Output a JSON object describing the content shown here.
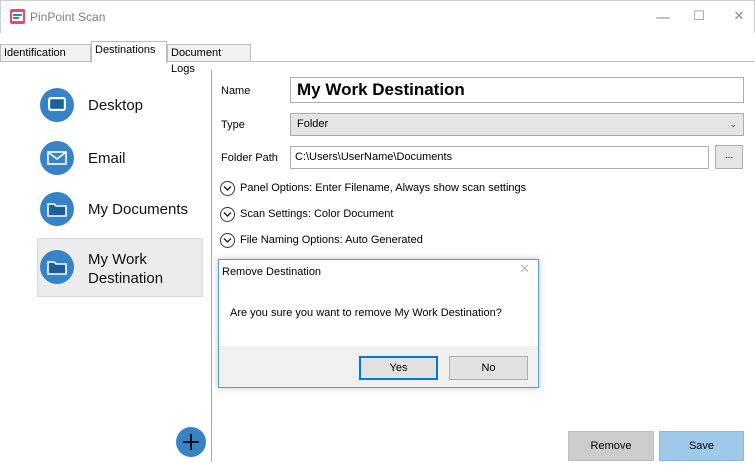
{
  "window": {
    "title": "PinPoint Scan",
    "minimize": "—",
    "maximize": "☐",
    "close": "✕"
  },
  "tabs": [
    {
      "label": "Identification",
      "active": false
    },
    {
      "label": "Destinations",
      "active": true
    },
    {
      "label": "Document Logs",
      "active": false
    }
  ],
  "sidebar": {
    "items": [
      {
        "label": "Desktop",
        "icon": "desktop-icon"
      },
      {
        "label": "Email",
        "icon": "email-icon"
      },
      {
        "label": "My Documents",
        "icon": "folder-icon"
      },
      {
        "label_line1": "My Work",
        "label_line2": "Destination",
        "icon": "folder-icon",
        "selected": true
      }
    ],
    "add_icon": "plus-icon"
  },
  "form": {
    "name_label": "Name",
    "name_value": "My Work Destination",
    "type_label": "Type",
    "type_value": "Folder",
    "path_label": "Folder Path",
    "path_value": "C:\\Users\\UserName\\Documents",
    "browse_label": "..."
  },
  "options": [
    "Panel Options: Enter Filename, Always show scan settings",
    "Scan Settings: Color Document",
    "File Naming Options: Auto Generated"
  ],
  "buttons": {
    "remove": "Remove",
    "save": "Save"
  },
  "dialog": {
    "title": "Remove Destination",
    "close": "✕",
    "message": "Are you sure you want to remove My Work Destination?",
    "yes": "Yes",
    "no": "No"
  },
  "colors": {
    "accent": "#3783c6",
    "save_button": "#9fc9ea",
    "dialog_border": "#5b9bd5"
  }
}
